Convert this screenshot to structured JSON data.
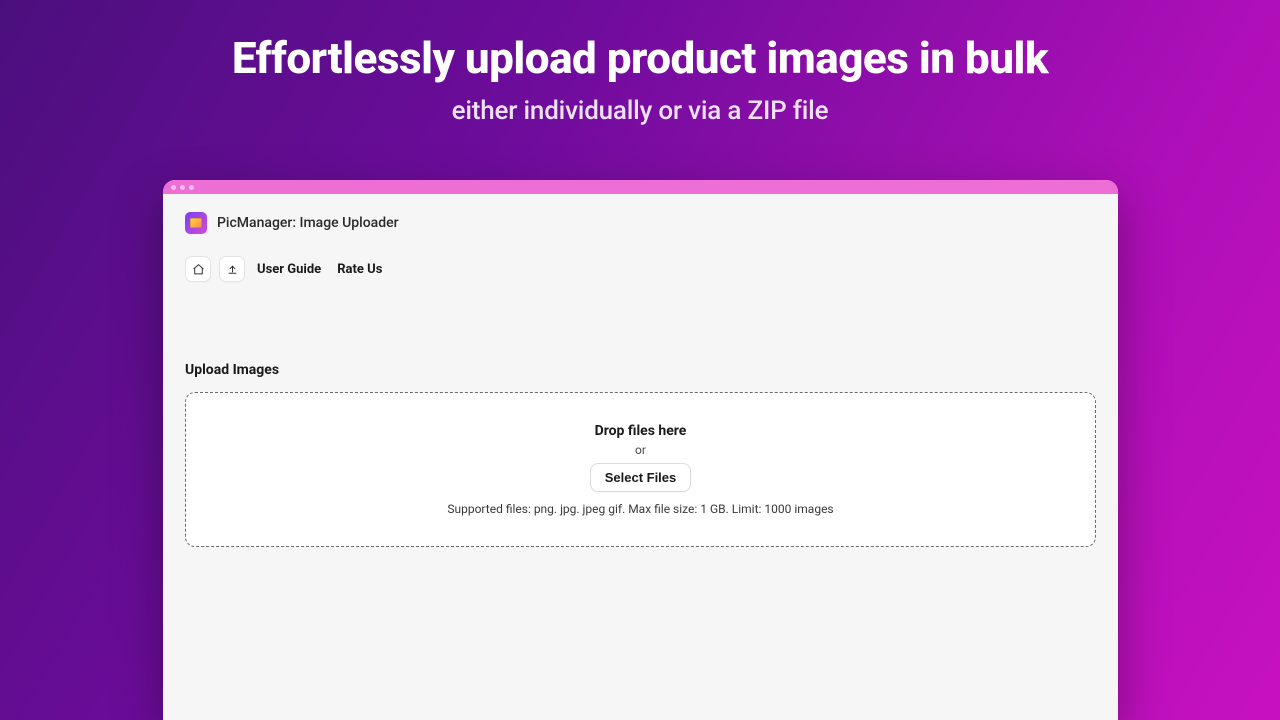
{
  "hero": {
    "headline": "Effortlessly upload product images in bulk",
    "subhead": "either individually or via a ZIP file"
  },
  "app": {
    "name": "PicManager: Image Uploader"
  },
  "toolbar": {
    "user_guide": "User Guide",
    "rate_us": "Rate Us"
  },
  "upload": {
    "section_title": "Upload Images",
    "drop_title": "Drop files here",
    "or": "or",
    "select_button": "Select Files",
    "hint": "Supported files: png. jpg. jpeg gif. Max file size: 1 GB. Limit: 1000 images"
  }
}
